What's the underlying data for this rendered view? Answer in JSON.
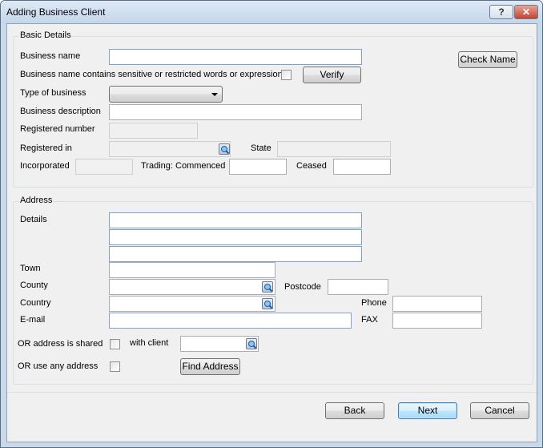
{
  "window": {
    "title": "Adding Business Client",
    "help_label": "?",
    "close_label": "✕"
  },
  "basic": {
    "group_title": "Basic Details",
    "business_name_label": "Business name",
    "business_name_value": "",
    "sensitive_label": "Business name contains sensitive or restricted words or expressions",
    "verify_label": "Verify",
    "check_name_label": "Check Name",
    "type_label": "Type of business",
    "type_value": "",
    "description_label": "Business description",
    "description_value": "",
    "registered_number_label": "Registered number",
    "registered_in_label": "Registered in",
    "state_label": "State",
    "incorporated_label": "Incorporated",
    "trading_label": "Trading: Commenced",
    "ceased_label": "Ceased"
  },
  "address": {
    "group_title": "Address",
    "details_label": "Details",
    "town_label": "Town",
    "county_label": "County",
    "postcode_label": "Postcode",
    "country_label": "Country",
    "phone_label": "Phone",
    "email_label": "E-mail",
    "fax_label": "FAX",
    "shared_label": "OR address is shared",
    "with_client_label": "with client",
    "any_address_label": "OR use any address",
    "find_address_label": "Find Address"
  },
  "footer": {
    "back_label": "Back",
    "next_label": "Next",
    "cancel_label": "Cancel"
  }
}
